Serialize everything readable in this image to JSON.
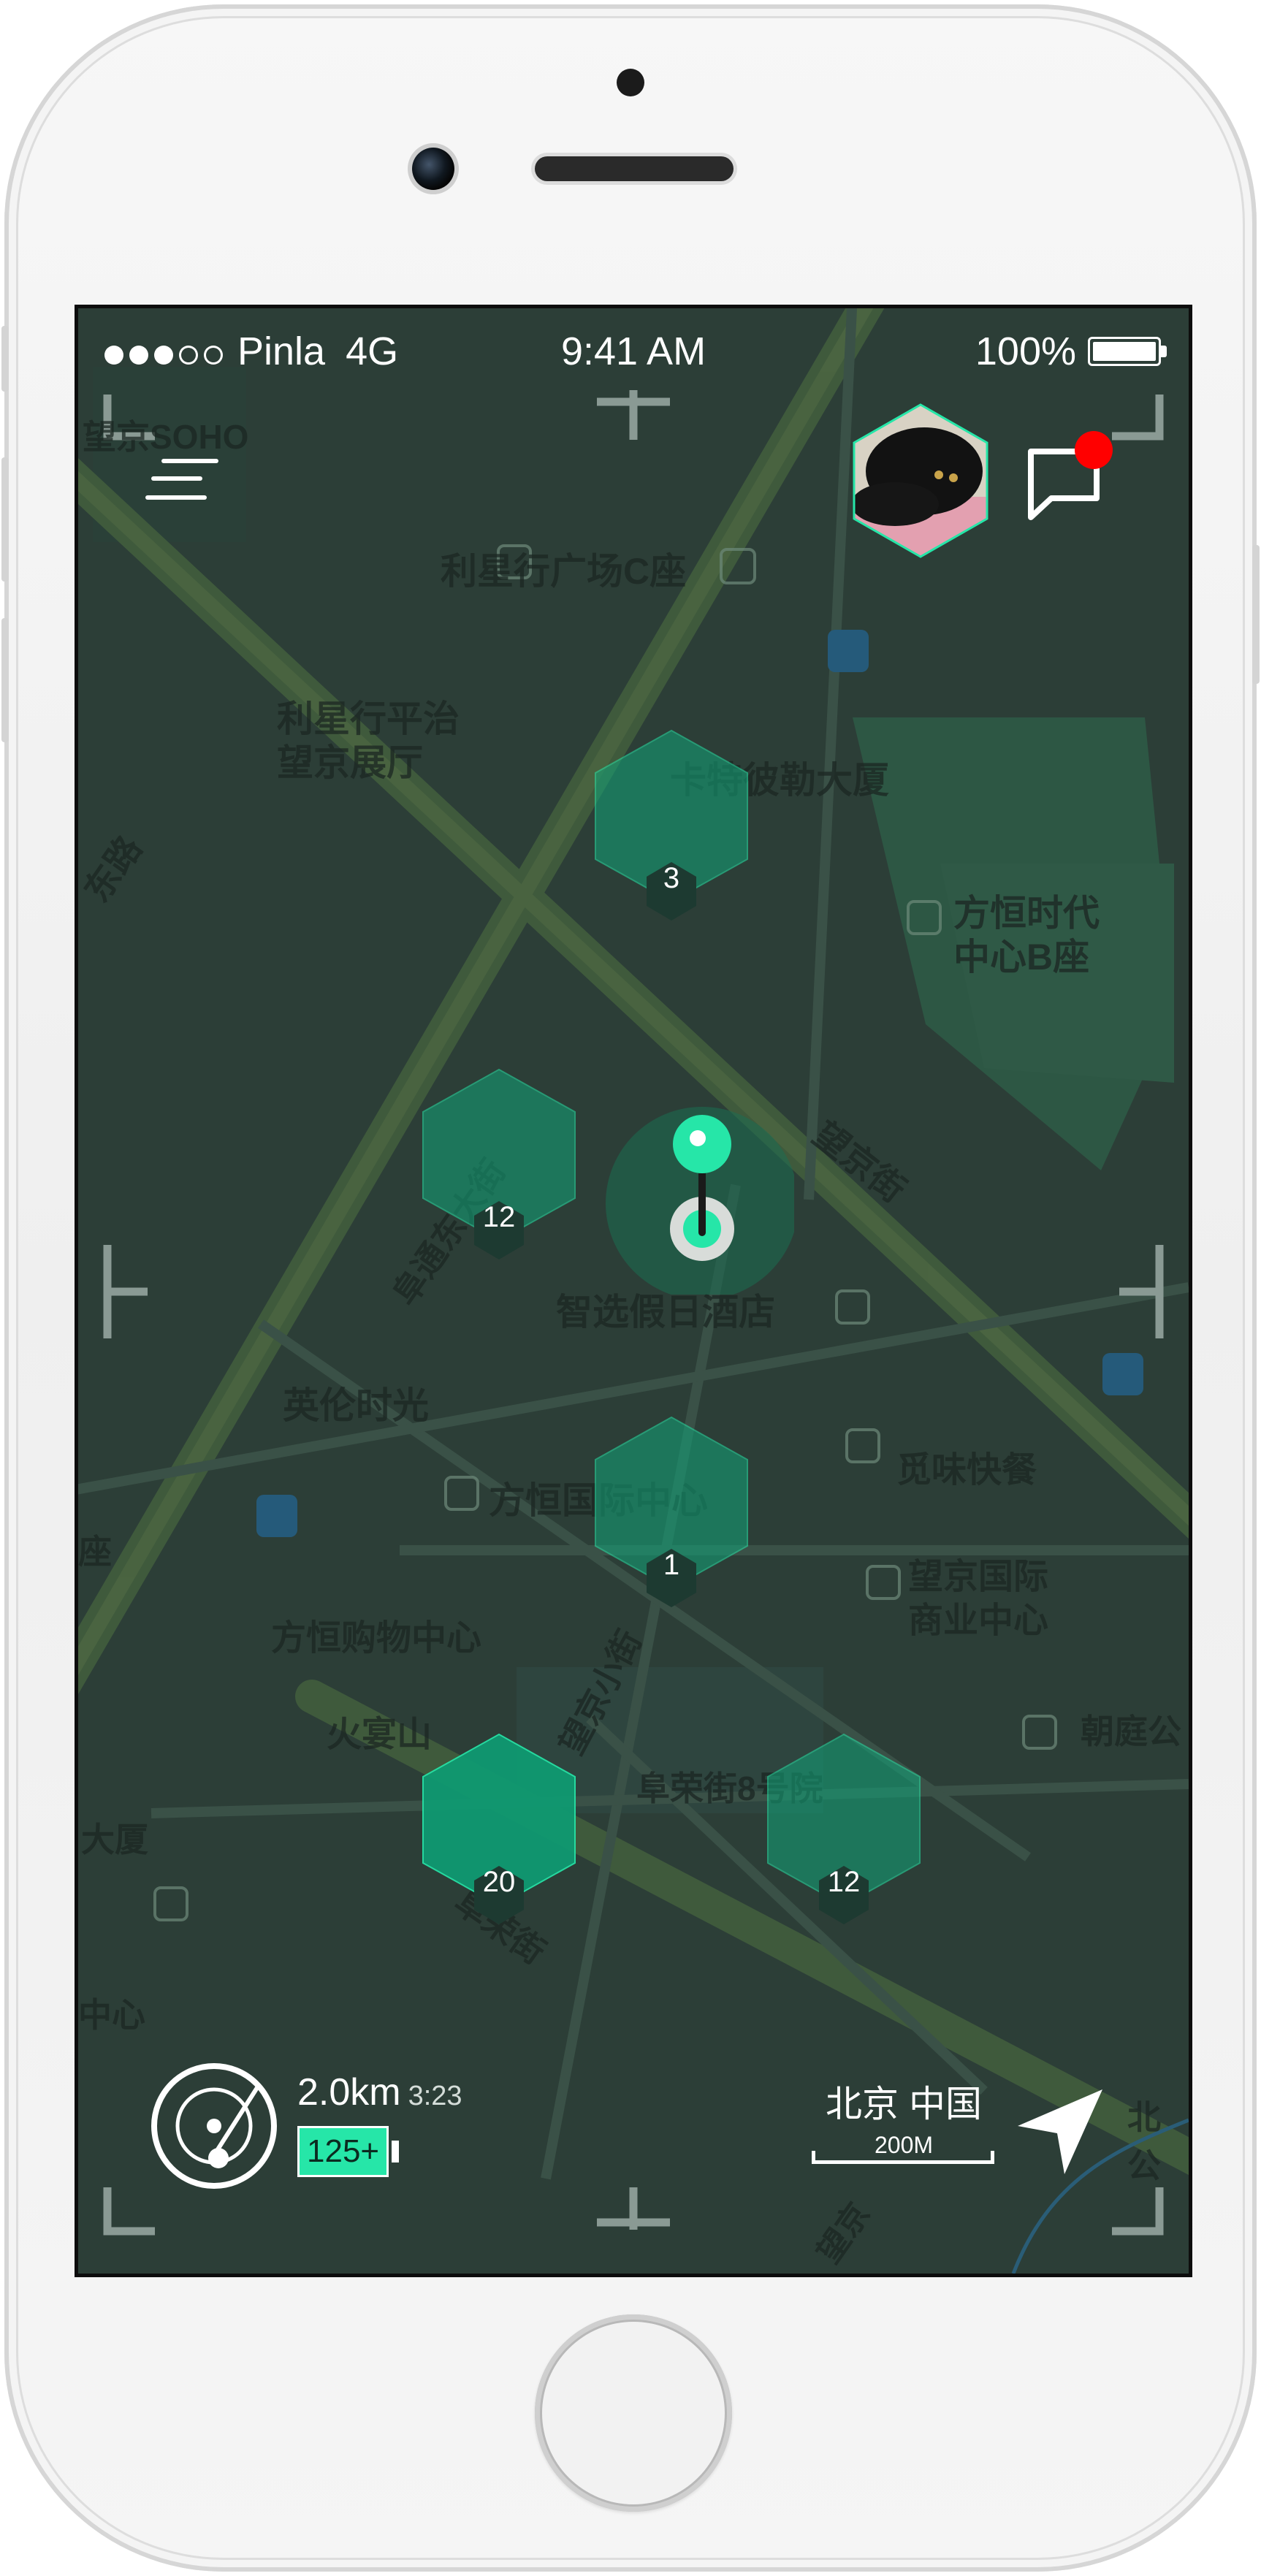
{
  "status_bar": {
    "carrier": "Pinla",
    "network": "4G",
    "time": "9:41 AM",
    "battery_percent": "100%",
    "signal_dots_filled": 3,
    "signal_dots_total": 5
  },
  "map_labels": [
    {
      "id": "poi-wangjing-soho",
      "text": "望京SOHO"
    },
    {
      "id": "poi-lixinghang-c",
      "text": "利星行广场C座"
    },
    {
      "id": "poi-lixinghang-pingzhi-1",
      "text": "利星行平治"
    },
    {
      "id": "poi-lixinghang-pingzhi-2",
      "text": "望京展厅"
    },
    {
      "id": "poi-caterpillar",
      "text": "卡特彼勒大厦"
    },
    {
      "id": "poi-fangheng-b-1",
      "text": "方恒时代"
    },
    {
      "id": "poi-fangheng-b-2",
      "text": "中心B座"
    },
    {
      "id": "road-wangjing-jie",
      "text": "望京街"
    },
    {
      "id": "road-dong-lu",
      "text": "东路"
    },
    {
      "id": "road-furong-dongdajie",
      "text": "阜通东大街"
    },
    {
      "id": "poi-holiday-inn",
      "text": "智选假日酒店"
    },
    {
      "id": "poi-yinglun",
      "text": "英伦时光"
    },
    {
      "id": "poi-fangheng-intl",
      "text": "方恒国际中心"
    },
    {
      "id": "poi-miwei",
      "text": "觅味快餐"
    },
    {
      "id": "poi-wangjing-intl-1",
      "text": "望京国际"
    },
    {
      "id": "poi-wangjing-intl-2",
      "text": "商业中心"
    },
    {
      "id": "poi-fangheng-mall",
      "text": "方恒购物中心"
    },
    {
      "id": "road-wangjing-xiaojie",
      "text": "望京小街"
    },
    {
      "id": "poi-huoyanshan",
      "text": "火宴山"
    },
    {
      "id": "poi-chaoting",
      "text": "朝庭公"
    },
    {
      "id": "poi-furongjie-8",
      "text": "阜荣街8号院"
    },
    {
      "id": "poi-dasha",
      "text": "大厦"
    },
    {
      "id": "road-furong-jie",
      "text": "阜荣街"
    },
    {
      "id": "poi-zhongxin",
      "text": "中心"
    },
    {
      "id": "road-wangjing-bottom",
      "text": "望京"
    },
    {
      "id": "poi-zuo-left",
      "text": "座"
    },
    {
      "id": "poi-bei-right",
      "text": "北公"
    }
  ],
  "clusters": [
    {
      "id": "cluster-caterpillar",
      "count": "3",
      "shade": "#0f8f6a"
    },
    {
      "id": "cluster-west",
      "count": "12",
      "shade": "#0f8f6a"
    },
    {
      "id": "cluster-fangheng",
      "count": "1",
      "shade": "#0f8f6a"
    },
    {
      "id": "cluster-southwest",
      "count": "20",
      "shade": "#0e9c73"
    },
    {
      "id": "cluster-southeast",
      "count": "12",
      "shade": "#0f8f6a"
    }
  ],
  "footer": {
    "distance": "2.0km",
    "duration": "3:23",
    "energy": "125+",
    "city": "北京 中国",
    "scale": "200M"
  },
  "colors": {
    "map_bg": "#2c3e37",
    "accent": "#26e6a8",
    "notification": "#ff0000"
  },
  "icons": {
    "menu": "hamburger-menu-icon",
    "chat": "chat-bubble-icon",
    "radar": "radar-icon",
    "navigate": "navigation-arrow-icon"
  }
}
